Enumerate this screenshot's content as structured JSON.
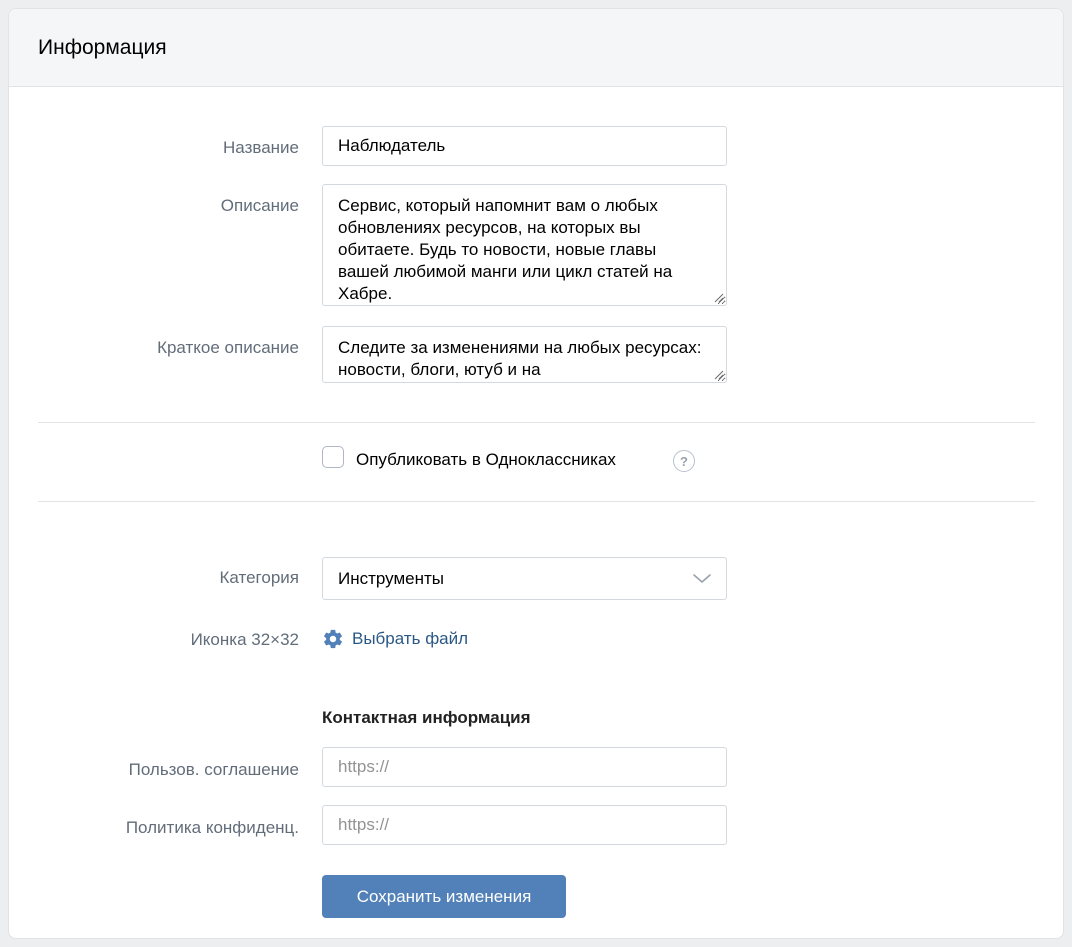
{
  "header": {
    "title": "Информация"
  },
  "form": {
    "name": {
      "label": "Название",
      "value": "Наблюдатель"
    },
    "description": {
      "label": "Описание",
      "value": "Сервис, который напомнит вам о любых обновлениях ресурсов, на которых вы обитаете. Будь то новости, новые главы вашей любимой манги или цикл статей на Хабре."
    },
    "short_description": {
      "label": "Краткое описание",
      "value": "Следите за изменениями на любых ресурсах: новости, блоги, ютуб и на"
    },
    "publish_ok": {
      "label": "Опубликовать в Одноклассниках",
      "checked": false,
      "help_glyph": "?"
    },
    "category": {
      "label": "Категория",
      "selected": "Инструменты",
      "icon": "chevron-down-icon"
    },
    "icon_upload": {
      "label": "Иконка 32×32",
      "link": "Выбрать файл",
      "icon": "gear-icon",
      "link_color": "#2a5885"
    },
    "contact": {
      "heading": "Контактная информация",
      "terms": {
        "label": "Пользов. соглашение",
        "value": "",
        "placeholder": "https://"
      },
      "privacy": {
        "label": "Политика конфиденц.",
        "value": "",
        "placeholder": "https://"
      }
    },
    "save_button": {
      "label": "Сохранить изменения",
      "color": "#5181b8"
    }
  }
}
